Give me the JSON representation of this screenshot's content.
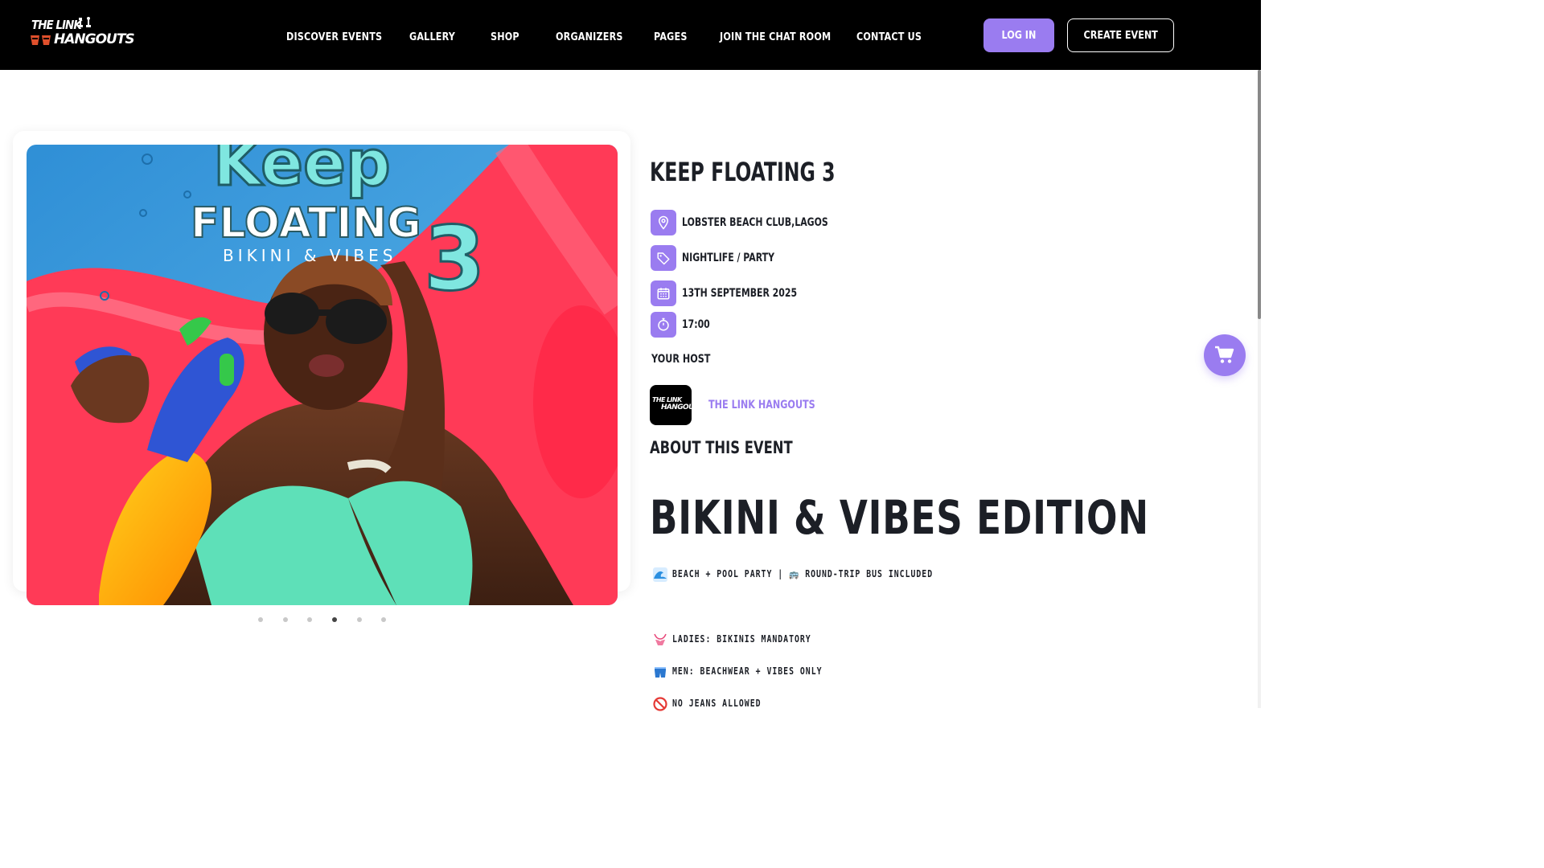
{
  "brand": {
    "logo_line1": "THE LINK",
    "logo_line2": "HANGOUTS"
  },
  "nav": {
    "items": [
      {
        "label": "DISCOVER EVENTS"
      },
      {
        "label": "GALLERY"
      },
      {
        "label": "SHOP"
      },
      {
        "label": "ORGANIZERS"
      },
      {
        "label": "PAGES"
      },
      {
        "label": "JOIN THE CHAT ROOM"
      },
      {
        "label": "CONTACT US"
      }
    ],
    "login_label": "LOG IN",
    "create_label": "CREATE EVENT"
  },
  "gallery": {
    "poster_title_top": "Keep",
    "poster_title_mid": "FLOATING",
    "poster_title_num": "3",
    "poster_subtitle": "BIKINI & VIBES",
    "slide_count": 6,
    "active_slide": 4
  },
  "event": {
    "title": "KEEP FLOATING 3",
    "location": "LOBSTER BEACH CLUB,LAGOS",
    "category": "NIGHTLIFE / PARTY",
    "date": "13TH SEPTEMBER 2025",
    "time": "17:00",
    "host_label": "YOUR HOST",
    "host_name": "THE LINK HANGOUTS",
    "host_avatar_line1": "THE LINK",
    "host_avatar_line2": "HANGOUTS",
    "about_label": "ABOUT THIS EVENT",
    "headline": "BIKINI & VIBES EDITION",
    "features": [
      {
        "icon": "wave-icon",
        "text": "BEACH + POOL PARTY | 🚌 ROUND-TRIP BUS INCLUDED"
      },
      {
        "icon": "bikini-icon",
        "text": "LADIES: BIKINIS MANDATORY"
      },
      {
        "icon": "shorts-icon",
        "text": "MEN: BEACHWEAR + VIBES ONLY"
      },
      {
        "icon": "no-entry-icon",
        "text": "NO JEANS ALLOWED"
      }
    ]
  },
  "colors": {
    "accent": "#9a7cf0",
    "nav_bg": "#000000",
    "text": "#1c1f26",
    "host_link": "#9a7cf0"
  }
}
